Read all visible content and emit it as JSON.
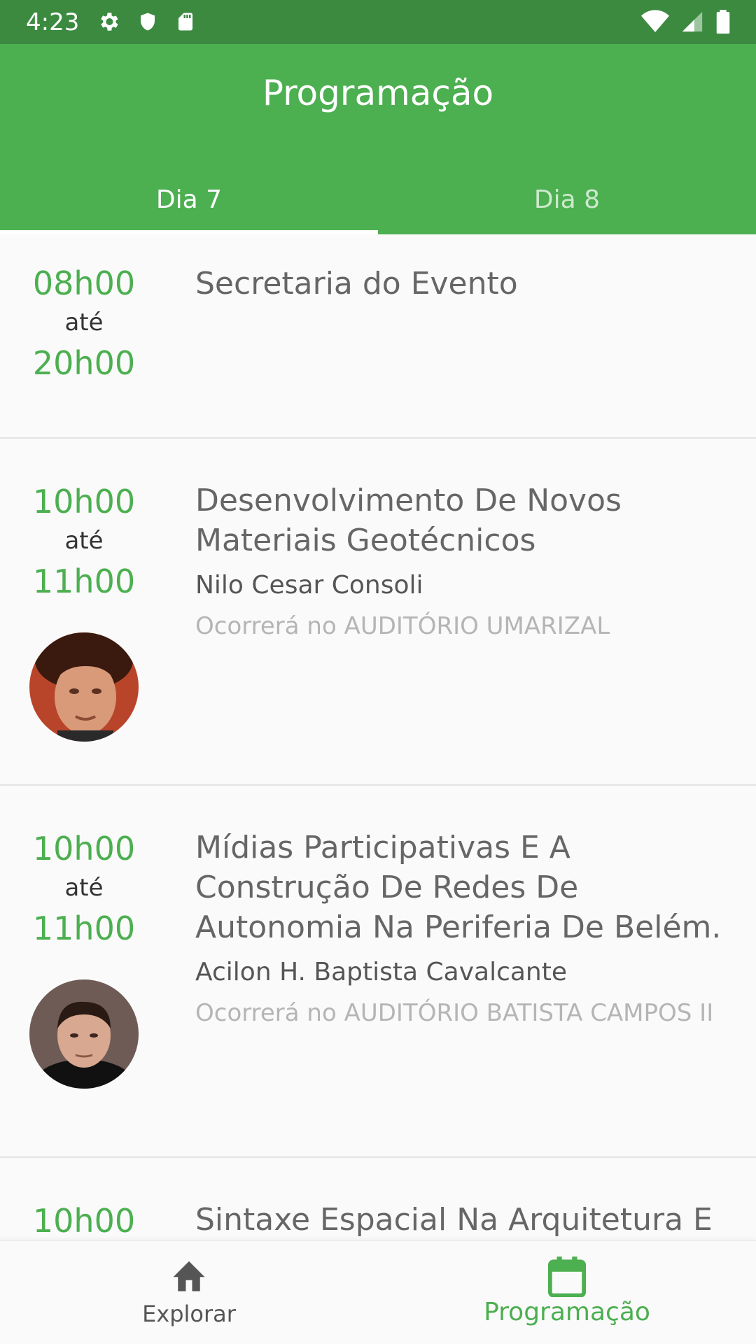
{
  "status_bar": {
    "time": "4:23"
  },
  "app_bar": {
    "title": "Programação",
    "tabs": [
      {
        "label": "Dia 7",
        "active": true
      },
      {
        "label": "Dia 8",
        "active": false
      }
    ]
  },
  "events": [
    {
      "start": "08h00",
      "until": "até",
      "end": "20h00",
      "title": "Secretaria do Evento"
    },
    {
      "start": "10h00",
      "until": "até",
      "end": "11h00",
      "title": "Desenvolvimento De Novos Materiais Geotécnicos",
      "speaker": "Nilo Cesar Consoli",
      "location": "Ocorrerá no AUDITÓRIO UMARIZAL"
    },
    {
      "start": "10h00",
      "until": "até",
      "end": "11h00",
      "title": "Mídias Participativas E A Construção De Redes De Autonomia Na Periferia De Belém.",
      "speaker": "Acilon H. Baptista Cavalcante",
      "location": "Ocorrerá no AUDITÓRIO BATISTA CAMPOS II"
    },
    {
      "start": "10h00",
      "title": "Sintaxe Espacial Na Arquitetura E"
    }
  ],
  "bottom_nav": {
    "items": [
      {
        "label": "Explorar",
        "icon": "home-icon",
        "active": false
      },
      {
        "label": "Programação",
        "icon": "calendar-icon",
        "active": true
      }
    ]
  },
  "colors": {
    "primary": "#4caf50",
    "status_bar": "#3b8a40"
  }
}
